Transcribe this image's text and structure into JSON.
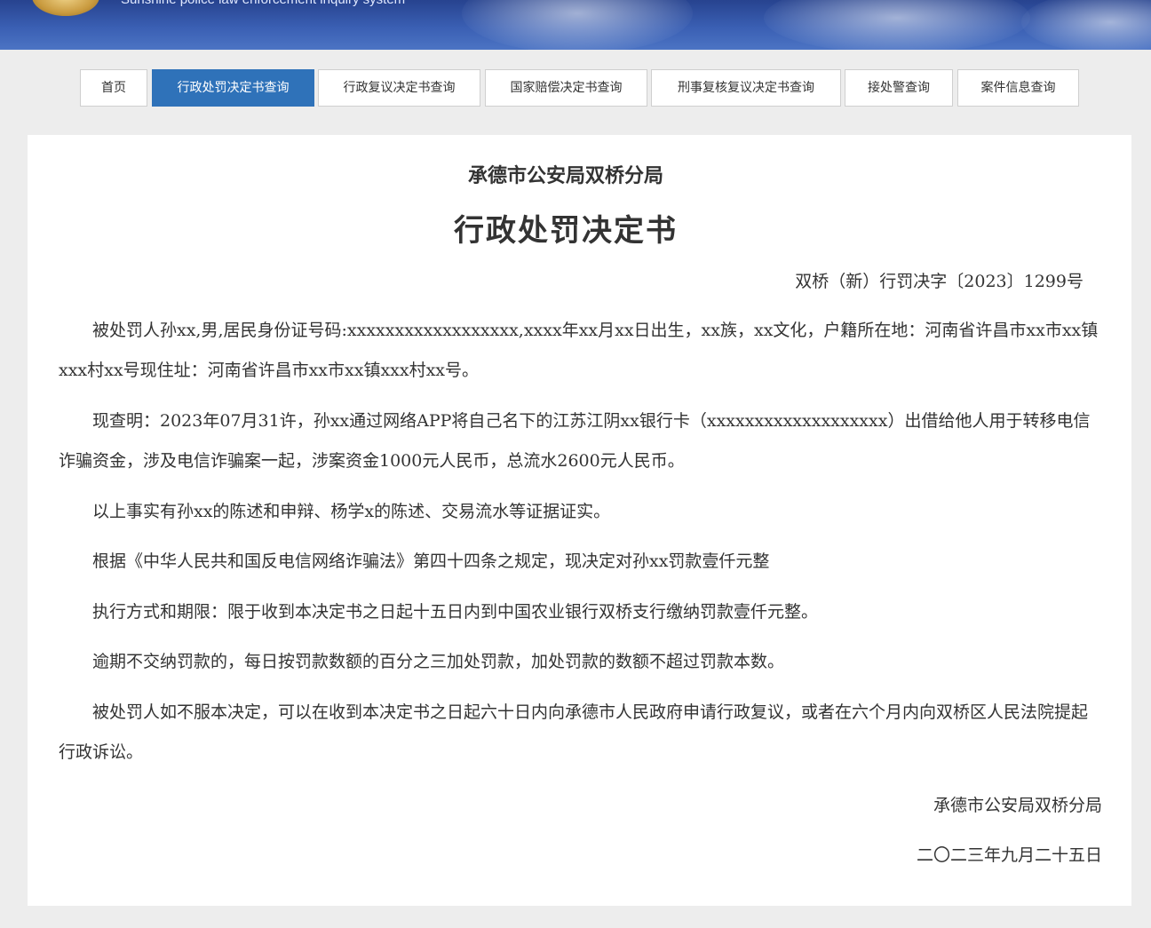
{
  "banner": {
    "subtitle": "Sunshine police law enforcement inquiry system"
  },
  "nav": {
    "items": [
      {
        "label": "首页",
        "active": false
      },
      {
        "label": "行政处罚决定书查询",
        "active": true
      },
      {
        "label": "行政复议决定书查询",
        "active": false
      },
      {
        "label": "国家赔偿决定书查询",
        "active": false
      },
      {
        "label": "刑事复核复议决定书查询",
        "active": false
      },
      {
        "label": "接处警查询",
        "active": false
      },
      {
        "label": "案件信息查询",
        "active": false
      }
    ]
  },
  "document": {
    "organization": "承德市公安局双桥分局",
    "title": "行政处罚决定书",
    "number": "双桥（新）行罚决字〔2023〕1299号",
    "paragraphs": [
      "被处罚人孙xx,男,居民身份证号码:xxxxxxxxxxxxxxxxxx,xxxx年xx月xx日出生，xx族，xx文化，户籍所在地：河南省许昌市xx市xx镇xxx村xx号现住址：河南省许昌市xx市xx镇xxx村xx号。",
      "现查明：2023年07月31许，孙xx通过网络APP将自己名下的江苏江阴xx银行卡（xxxxxxxxxxxxxxxxxxx）出借给他人用于转移电信诈骗资金，涉及电信诈骗案一起，涉案资金1000元人民币，总流水2600元人民币。",
      "以上事实有孙xx的陈述和申辩、杨学x的陈述、交易流水等证据证实。",
      "根据《中华人民共和国反电信网络诈骗法》第四十四条之规定，现决定对孙xx罚款壹仟元整",
      "执行方式和期限：限于收到本决定书之日起十五日内到中国农业银行双桥支行缴纳罚款壹仟元整。",
      "逾期不交纳罚款的，每日按罚款数额的百分之三加处罚款，加处罚款的数额不超过罚款本数。",
      "被处罚人如不服本决定，可以在收到本决定书之日起六十日内向承德市人民政府申请行政复议，或者在六个月内向双桥区人民法院提起行政诉讼。"
    ],
    "signature": "承德市公安局双桥分局",
    "date": "二〇二三年九月二十五日"
  },
  "colors": {
    "active_tab": "#2f72b9",
    "banner": "#3a5fb3",
    "page_background": "#ededed"
  }
}
